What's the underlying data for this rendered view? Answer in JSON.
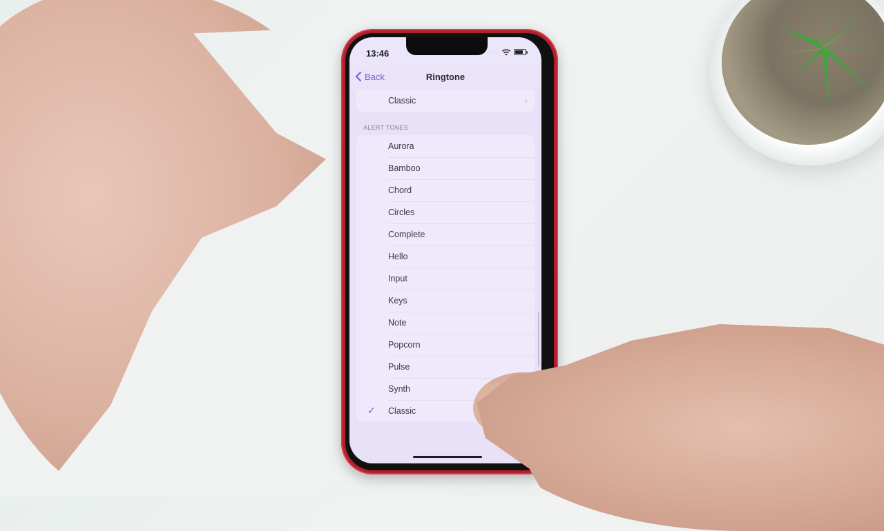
{
  "status_bar": {
    "time": "13:46",
    "signal_icon": "cellular-dots-icon",
    "wifi_icon": "wifi-icon",
    "battery_icon": "battery-icon",
    "battery_level_percent": 80
  },
  "nav": {
    "back_label": "Back",
    "title": "Ringtone"
  },
  "top_group": {
    "items": [
      {
        "label": "Classic",
        "chevron": true
      }
    ]
  },
  "alert_tones": {
    "header": "ALERT TONES",
    "items": [
      {
        "label": "Aurora",
        "selected": false
      },
      {
        "label": "Bamboo",
        "selected": false
      },
      {
        "label": "Chord",
        "selected": false
      },
      {
        "label": "Circles",
        "selected": false
      },
      {
        "label": "Complete",
        "selected": false
      },
      {
        "label": "Hello",
        "selected": false
      },
      {
        "label": "Input",
        "selected": false
      },
      {
        "label": "Keys",
        "selected": false
      },
      {
        "label": "Note",
        "selected": false
      },
      {
        "label": "Popcorn",
        "selected": false
      },
      {
        "label": "Pulse",
        "selected": false
      },
      {
        "label": "Synth",
        "selected": false
      },
      {
        "label": "Classic",
        "selected": true
      }
    ]
  },
  "checkmark_glyph": "✓",
  "chevron_glyph": "›",
  "colors": {
    "accent": "#6b63d8",
    "phone_body": "#b41f2e",
    "screen_background": "#e8e1f7"
  }
}
